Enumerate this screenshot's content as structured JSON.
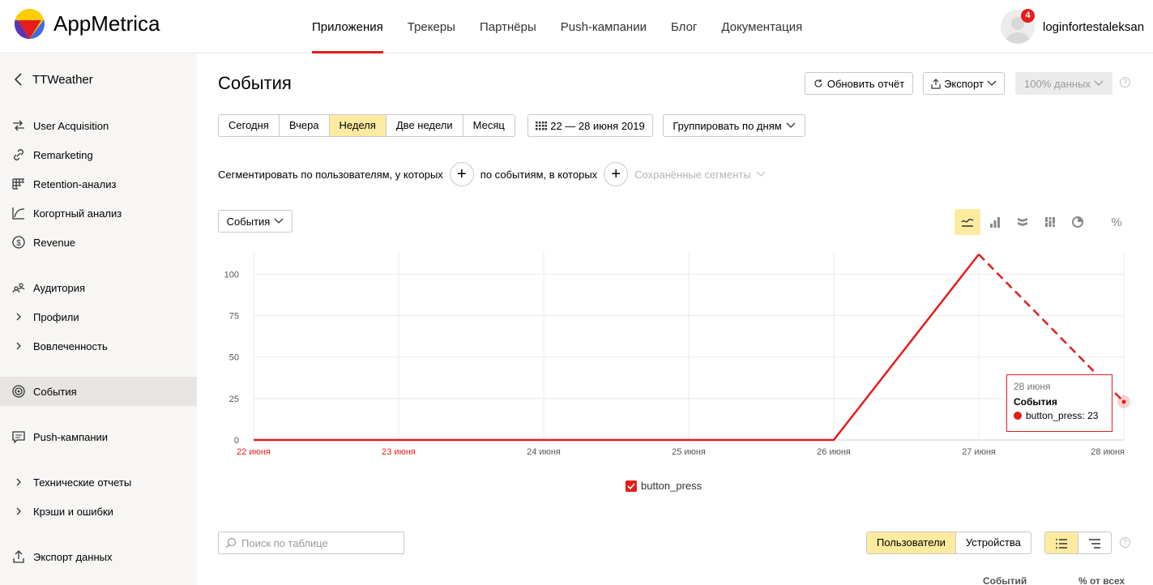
{
  "app": {
    "name": "AppMetrica"
  },
  "nav": {
    "items": [
      "Приложения",
      "Трекеры",
      "Партнёры",
      "Push-кампании",
      "Блог",
      "Документация"
    ],
    "active": "Приложения"
  },
  "user": {
    "name": "loginfortestaleksan",
    "notifications": "4"
  },
  "sidebar": {
    "back_label": "TTWeather",
    "items": [
      {
        "label": "User Acquisition",
        "icon": "arrows-icon"
      },
      {
        "label": "Remarketing",
        "icon": "link-icon"
      },
      {
        "label": "Retention-анализ",
        "icon": "grid-icon"
      },
      {
        "label": "Когортный анализ",
        "icon": "curve-icon"
      },
      {
        "label": "Revenue",
        "icon": "dollar-icon"
      },
      {
        "label": "Аудитория",
        "icon": "people-icon"
      },
      {
        "label": "Профили",
        "icon": "chevron-right-icon"
      },
      {
        "label": "Вовлеченность",
        "icon": "chevron-right-icon"
      },
      {
        "label": "События",
        "icon": "target-icon"
      },
      {
        "label": "Push-кампании",
        "icon": "message-icon"
      },
      {
        "label": "Технические отчеты",
        "icon": "chevron-right-icon"
      },
      {
        "label": "Крэши и ошибки",
        "icon": "chevron-right-icon"
      },
      {
        "label": "Экспорт данных",
        "icon": "upload-icon"
      }
    ],
    "active": "События"
  },
  "page": {
    "title": "События",
    "refresh_label": "Обновить отчёт",
    "export_label": "Экспорт",
    "data_percent_label": "100% данных"
  },
  "periods": {
    "items": [
      "Сегодня",
      "Вчера",
      "Неделя",
      "Две недели",
      "Месяц"
    ],
    "active": "Неделя"
  },
  "date_range": "22 — 28 июня 2019",
  "group_by": "Группировать по дням",
  "segment": {
    "users_label": "Сегментировать по пользователям, у которых",
    "events_label": "по событиям, в которых",
    "saved_label": "Сохранённые сегменты"
  },
  "metric_select": "События",
  "percent_label": "%",
  "chart_data": {
    "type": "line",
    "x": [
      "22 июня",
      "23 июня",
      "24 июня",
      "25 июня",
      "26 июня",
      "27 июня",
      "28 июня"
    ],
    "weekend_x": [
      "22 июня",
      "23 июня"
    ],
    "ylim": [
      0,
      110
    ],
    "yticks": [
      0,
      25,
      50,
      75,
      100
    ],
    "series": [
      {
        "name": "button_press",
        "values": [
          0,
          0,
          0,
          0,
          0,
          112,
          23
        ],
        "color": "#e51d1d",
        "incomplete_from_index": 5
      }
    ]
  },
  "tooltip": {
    "date": "28 июня",
    "title": "События",
    "series": "button_press",
    "value": "23"
  },
  "legend": {
    "label": "button_press"
  },
  "table": {
    "search_placeholder": "Поиск по таблице",
    "tabs": [
      "Пользователи",
      "Устройства"
    ],
    "active_tab": "Пользователи",
    "columns": [
      "Событий",
      "% от всех"
    ]
  }
}
